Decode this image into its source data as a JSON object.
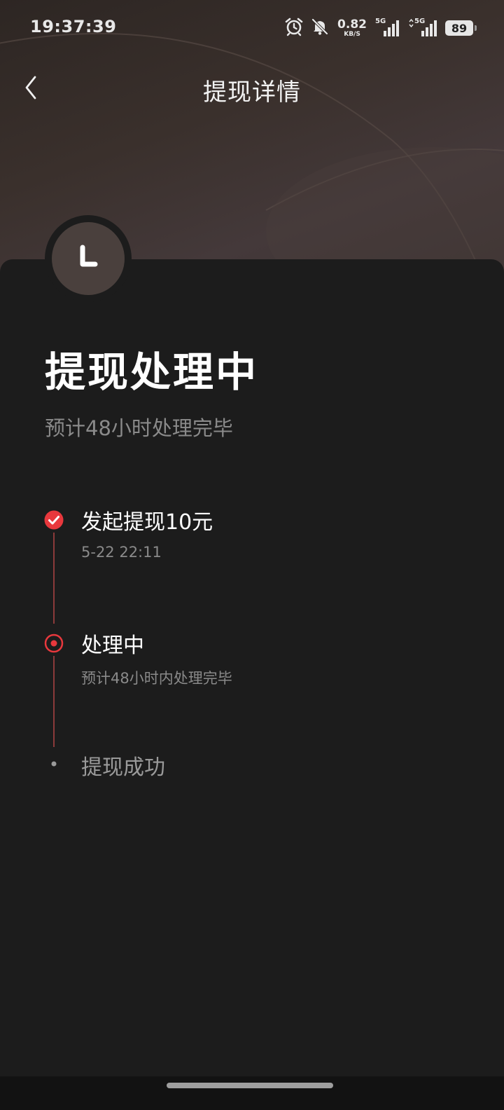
{
  "status_bar": {
    "time": "19:37:39",
    "net_speed_value": "0.82",
    "net_speed_unit": "KB/S",
    "signal_1_label": "5G",
    "signal_2_label": "5G",
    "battery": "89",
    "icons": [
      "alarm-icon",
      "bell-off-icon",
      "signal-icon",
      "signal-icon"
    ]
  },
  "header": {
    "title": "提现详情",
    "back_icon": "chevron-left-icon"
  },
  "status": {
    "icon": "clock-icon",
    "title": "提现处理中",
    "subtitle": "预计48小时处理完毕"
  },
  "timeline": {
    "steps": [
      {
        "title": "发起提现10元",
        "desc": "5-22 22:11",
        "state": "done",
        "icon": "check-circle-icon"
      },
      {
        "title": "处理中",
        "desc": "预计48小时内处理完毕",
        "state": "current",
        "icon": "radio-dot-icon"
      },
      {
        "title": "提现成功",
        "desc": "",
        "state": "pending",
        "icon": "dot-icon"
      }
    ]
  },
  "colors": {
    "accent": "#e8383d",
    "background": "#1c1c1c",
    "hero": "#3a302c",
    "timeline_line": "#8c3a3a",
    "text_primary": "#ffffff",
    "text_secondary": "#8a8a8a",
    "text_pending": "#9a9a9a"
  }
}
